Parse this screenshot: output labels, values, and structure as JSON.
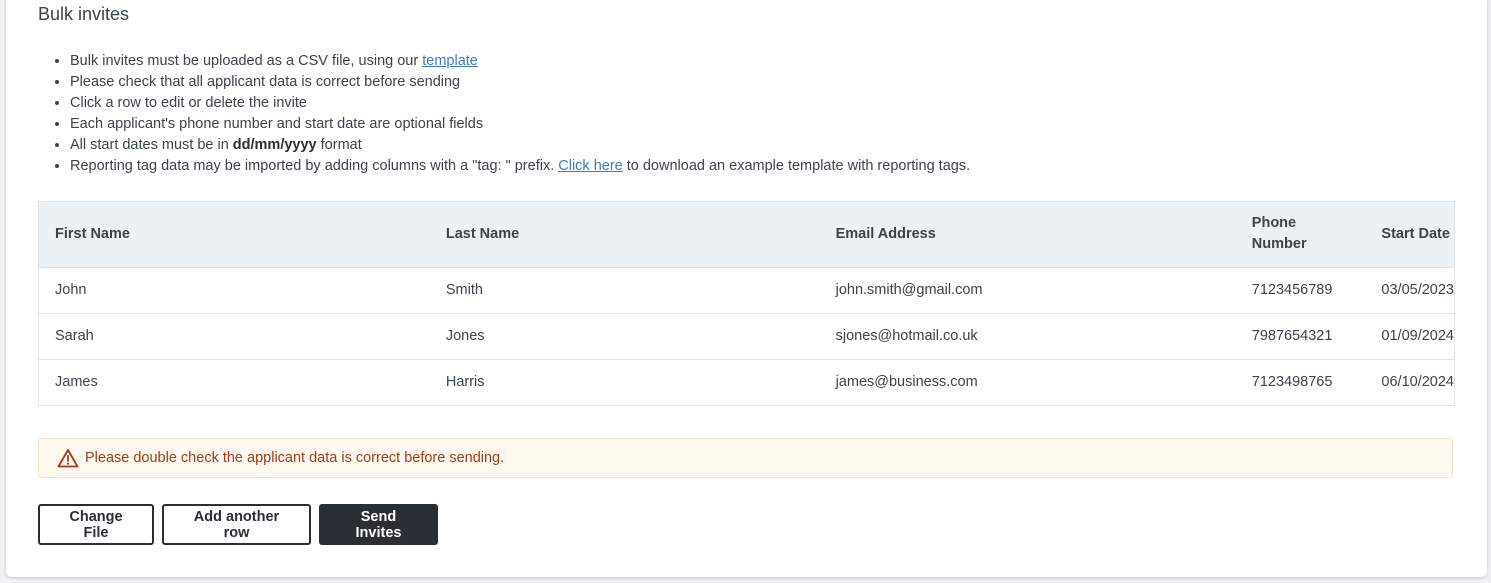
{
  "page": {
    "title": "Bulk invites"
  },
  "instructions": {
    "item1_text": "Bulk invites must be uploaded as a CSV file, using our ",
    "item1_link": "template",
    "item2": "Please check that all applicant data is correct before sending",
    "item3": "Click a row to edit or delete the invite",
    "item4": "Each applicant's phone number and start date are optional fields",
    "item5_before": "All start dates must be in ",
    "item5_bold": "dd/mm/yyyy",
    "item5_after": " format",
    "item6_before": "Reporting tag data may be imported by adding columns with a \"tag: \" prefix. ",
    "item6_link": "Click here",
    "item6_after": " to download an example template with reporting tags."
  },
  "table": {
    "headers": {
      "first_name": "First Name",
      "last_name": "Last Name",
      "email": "Email Address",
      "phone_line1": "Phone",
      "phone_line2": "Number",
      "start_date": "Start Date"
    },
    "rows": [
      {
        "first_name": "John",
        "last_name": "Smith",
        "email": "john.smith@gmail.com",
        "phone": "7123456789",
        "start_date": "03/05/2023"
      },
      {
        "first_name": "Sarah",
        "last_name": "Jones",
        "email": "sjones@hotmail.co.uk",
        "phone": "7987654321",
        "start_date": "01/09/2024"
      },
      {
        "first_name": "James",
        "last_name": "Harris",
        "email": "james@business.com",
        "phone": "7123498765",
        "start_date": "06/10/2024"
      }
    ]
  },
  "warning": {
    "icon": "warning-triangle-icon",
    "text": "Please double check the applicant data is correct before sending.",
    "color": "#a33a20"
  },
  "actions": {
    "change_file": "Change File",
    "add_row": "Add another row",
    "send_invites": "Send Invites"
  },
  "colors": {
    "link": "#3e7cc9",
    "primary_button": "#2a2f35",
    "table_header_bg": "#ecf1f6",
    "warning_bg": "#fef9ee"
  }
}
